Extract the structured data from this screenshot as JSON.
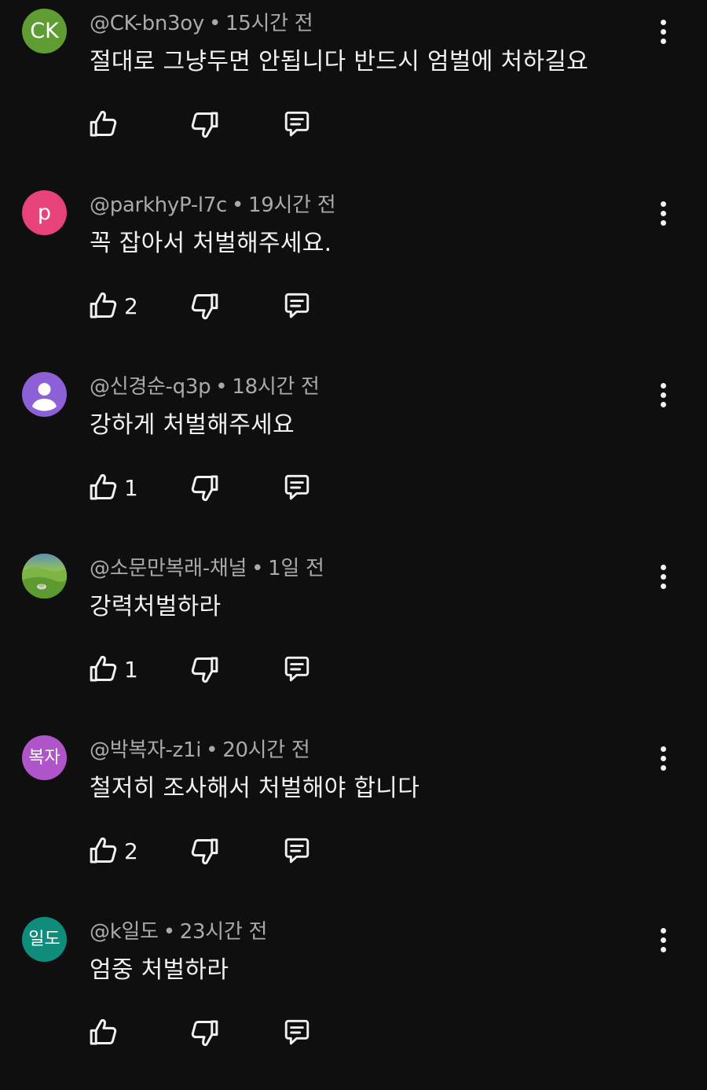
{
  "comments": [
    {
      "avatar": {
        "type": "initials",
        "text": "CK",
        "color": "#5f9d32"
      },
      "handle": "@CK-bn3oy",
      "time": "15시간 전",
      "text": "절대로 그냥두면 안됩니다 반드시 엄벌에 처하길요",
      "likes": ""
    },
    {
      "avatar": {
        "type": "initials",
        "text": "p",
        "color": "#e7427a"
      },
      "handle": "@parkhyP-l7c",
      "time": "19시간 전",
      "text": "꼭 잡아서 처벌해주세요.",
      "likes": "2"
    },
    {
      "avatar": {
        "type": "person",
        "text": "",
        "color": "#8e60d8"
      },
      "handle": "@신경순-q3p",
      "time": "18시간 전",
      "text": "강하게 처벌해주세요",
      "likes": "1"
    },
    {
      "avatar": {
        "type": "photo",
        "text": "",
        "color": "#6a9a3a"
      },
      "handle": "@소문만복래-채널",
      "time": "1일 전",
      "text": "강력처벌하라",
      "likes": "1"
    },
    {
      "avatar": {
        "type": "initials",
        "text": "복자",
        "color": "#b054c9"
      },
      "handle": "@박복자-z1i",
      "time": "20시간 전",
      "text": "철저히 조사해서 처벌해야 합니다",
      "likes": "2"
    },
    {
      "avatar": {
        "type": "initials",
        "text": "일도",
        "color": "#0f8c7c"
      },
      "handle": "@k일도",
      "time": "23시간 전",
      "text": "엄중 처벌하라",
      "likes": ""
    }
  ],
  "separator": "•",
  "icons": {
    "like": "thumbs-up-icon",
    "dislike": "thumbs-down-icon",
    "reply": "reply-icon",
    "menu": "more-vert-icon"
  }
}
